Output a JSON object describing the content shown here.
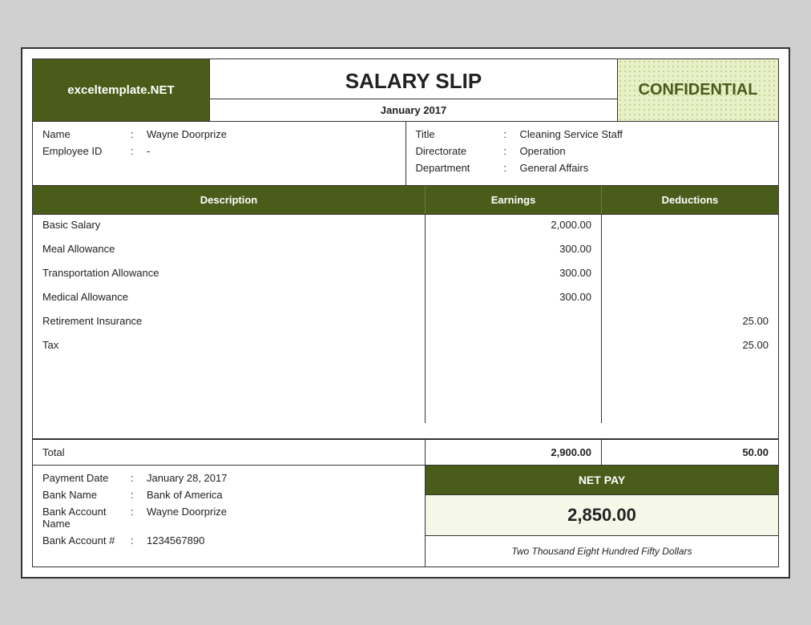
{
  "header": {
    "logo": "exceltemplate.NET",
    "title": "SALARY SLIP",
    "month": "January 2017",
    "confidential": "CONFIDENTIAL"
  },
  "employee": {
    "left": {
      "name_label": "Name",
      "name_colon": ":",
      "name_value": "Wayne Doorprize",
      "id_label": "Employee ID",
      "id_colon": ":",
      "id_value": "-"
    },
    "right": {
      "title_label": "Title",
      "title_colon": ":",
      "title_value": "Cleaning Service Staff",
      "directorate_label": "Directorate",
      "directorate_colon": ":",
      "directorate_value": "Operation",
      "department_label": "Department",
      "department_colon": ":",
      "department_value": "General Affairs"
    }
  },
  "table": {
    "headers": {
      "description": "Description",
      "earnings": "Earnings",
      "deductions": "Deductions"
    },
    "rows": [
      {
        "description": "Basic Salary",
        "earnings": "2,000.00",
        "deductions": ""
      },
      {
        "description": "Meal Allowance",
        "earnings": "300.00",
        "deductions": ""
      },
      {
        "description": "Transportation Allowance",
        "earnings": "300.00",
        "deductions": ""
      },
      {
        "description": "Medical Allowance",
        "earnings": "300.00",
        "deductions": ""
      },
      {
        "description": "Retirement Insurance",
        "earnings": "",
        "deductions": "25.00"
      },
      {
        "description": "Tax",
        "earnings": "",
        "deductions": "25.00"
      }
    ],
    "total": {
      "label": "Total",
      "earnings": "2,900.00",
      "deductions": "50.00"
    }
  },
  "payment": {
    "date_label": "Payment Date",
    "date_colon": ":",
    "date_value": "January 28, 2017",
    "bank_label": "Bank Name",
    "bank_colon": ":",
    "bank_value": "Bank of America",
    "account_name_label": "Bank Account Name",
    "account_name_colon": ":",
    "account_name_value": "Wayne Doorprize",
    "account_num_label": "Bank Account #",
    "account_num_colon": ":",
    "account_num_value": "1234567890"
  },
  "net_pay": {
    "header": "NET PAY",
    "amount": "2,850.00",
    "words": "Two Thousand Eight Hundred Fifty Dollars"
  }
}
